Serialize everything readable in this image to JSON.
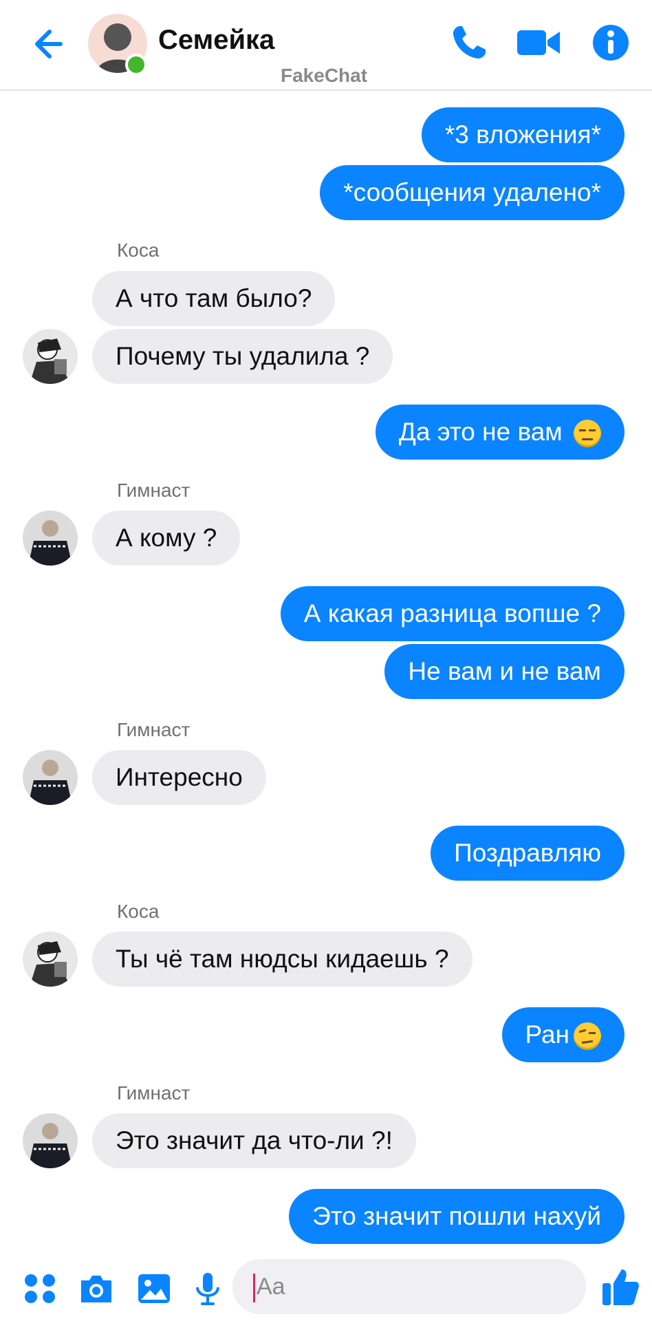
{
  "header": {
    "title": "Семейка",
    "watermark": "FakeChat",
    "icons": [
      "back-arrow-icon",
      "phone-icon",
      "video-camera-icon",
      "info-icon"
    ],
    "accent_color": "#0a84ff",
    "online_color": "#42b72a"
  },
  "messages": [
    {
      "dir": "out",
      "text": "*3 вложения*"
    },
    {
      "dir": "out",
      "text": "*сообщения удалено*"
    },
    {
      "dir": "in",
      "sender": "Коса",
      "text": "А что там было?"
    },
    {
      "dir": "in",
      "text": "Почему ты удалила ?"
    },
    {
      "dir": "out",
      "text": "Да это не вам",
      "emoji": "expressionless-face"
    },
    {
      "dir": "in",
      "sender": "Гимнаст",
      "text": "А кому ?"
    },
    {
      "dir": "out",
      "text": "А какая разница вопше ?"
    },
    {
      "dir": "out",
      "text": "Не вам и не вам"
    },
    {
      "dir": "in",
      "sender": "Гимнаст",
      "text": "Интересно"
    },
    {
      "dir": "out",
      "text": "Поздравляю"
    },
    {
      "dir": "in",
      "sender": "Коса",
      "text": "Ты чё там нюдсы кидаешь ?"
    },
    {
      "dir": "out",
      "text": "Ран",
      "emoji": "raised-eyebrow-face"
    },
    {
      "dir": "in",
      "sender": "Гимнаст",
      "text": "Это значит да что-ли ?!"
    },
    {
      "dir": "out",
      "text": "Это значит пошли нахуй"
    }
  ],
  "composer": {
    "placeholder": "Aa",
    "icons": [
      "apps-grid-icon",
      "camera-icon",
      "image-icon",
      "microphone-icon",
      "emoji-icon",
      "thumbs-up-icon"
    ]
  }
}
